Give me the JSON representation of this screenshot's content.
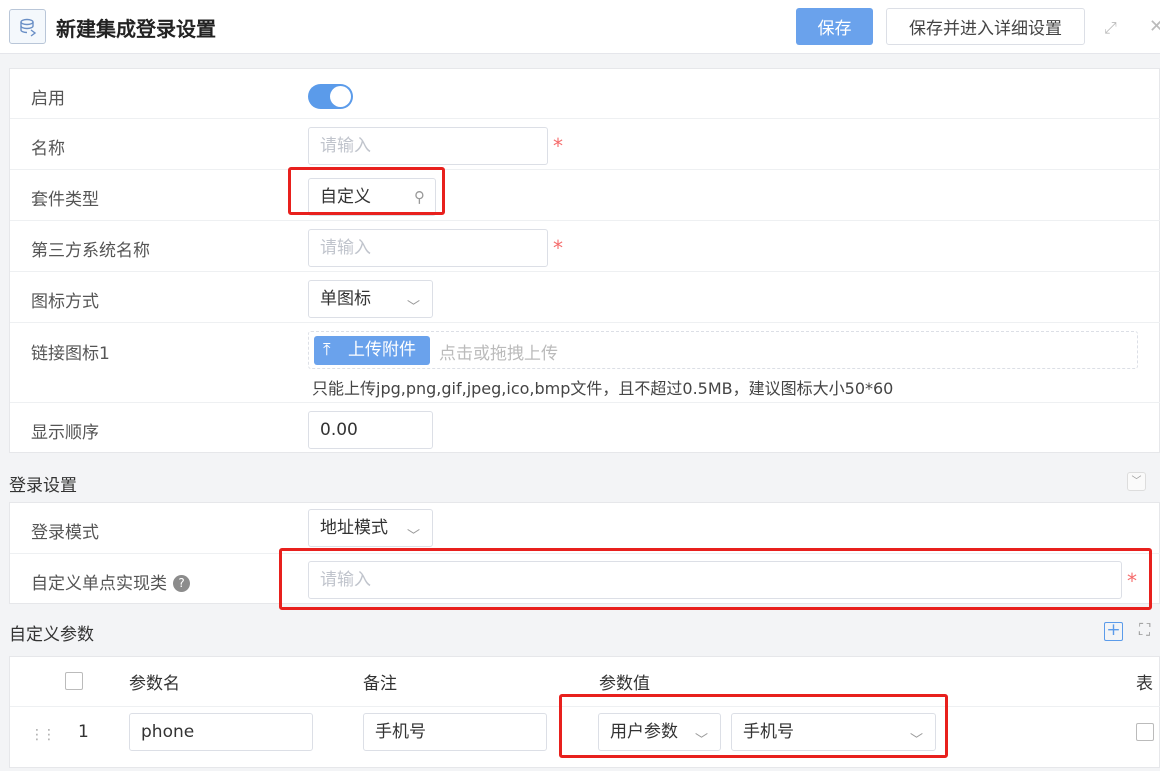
{
  "header": {
    "title": "新建集成登录设置",
    "save_label": "保存",
    "save_detail_label": "保存并进入详细设置",
    "icons": [
      "app-icon",
      "expand-icon",
      "close-icon"
    ]
  },
  "basic": {
    "enable_label": "启用",
    "enabled": true,
    "name_label": "名称",
    "name_placeholder": "请输入",
    "suite_type_label": "套件类型",
    "suite_type_value": "自定义",
    "third_party_label": "第三方系统名称",
    "third_party_placeholder": "请输入",
    "icon_mode_label": "图标方式",
    "icon_mode_value": "单图标",
    "link_icon_label": "链接图标1",
    "upload_button": "上传附件",
    "upload_hint": "点击或拖拽上传",
    "upload_desc": "只能上传jpg,png,gif,jpeg,ico,bmp文件，且不超过0.5MB，建议图标大小50*60",
    "order_label": "显示顺序",
    "order_value": "0.00"
  },
  "login": {
    "section_title": "登录设置",
    "mode_label": "登录模式",
    "mode_value": "地址模式",
    "sso_class_label": "自定义单点实现类",
    "sso_class_placeholder": "请输入"
  },
  "params": {
    "section_title": "自定义参数",
    "columns": [
      "参数名",
      "备注",
      "参数值",
      "表"
    ],
    "rows": [
      {
        "index": "1",
        "name": "phone",
        "remark": "手机号",
        "value_type": "用户参数",
        "value": "手机号"
      }
    ]
  },
  "colors": {
    "primary": "#6aa2ec",
    "highlight": "#e8201d",
    "required": "#f56c6c"
  }
}
